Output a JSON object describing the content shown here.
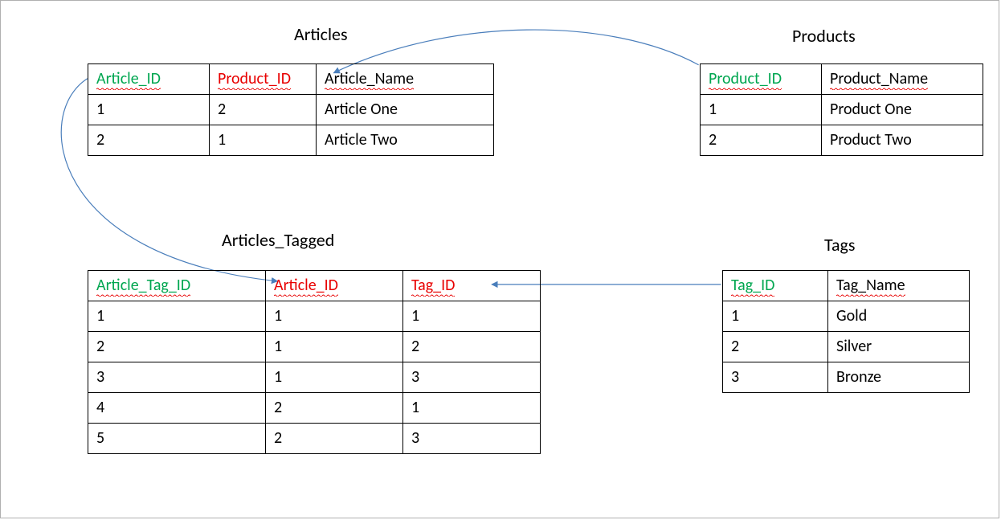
{
  "colors": {
    "pk": "#00a650",
    "fk": "#e80000",
    "connector": "#4a7ebb"
  },
  "connectors": [
    {
      "from": "Products.Product_ID",
      "to": "Articles.Product_ID"
    },
    {
      "from": "Articles.Article_ID",
      "to": "Articles_Tagged.Article_ID"
    },
    {
      "from": "Tags.Tag_ID",
      "to": "Articles_Tagged.Tag_ID"
    }
  ],
  "tables": {
    "articles": {
      "title": "Articles",
      "columns": [
        {
          "name": "Article_ID",
          "role": "pk"
        },
        {
          "name": "Product_ID",
          "role": "fk"
        },
        {
          "name": "Article_Name",
          "role": "plain"
        }
      ],
      "rows": [
        {
          "c0": "1",
          "c1": "2",
          "c2": "Article One"
        },
        {
          "c0": "2",
          "c1": "1",
          "c2": "Article Two"
        }
      ]
    },
    "products": {
      "title": "Products",
      "columns": [
        {
          "name": "Product_ID",
          "role": "pk"
        },
        {
          "name": "Product_Name",
          "role": "plain"
        }
      ],
      "rows": [
        {
          "c0": "1",
          "c1": "Product One"
        },
        {
          "c0": "2",
          "c1": "Product Two"
        }
      ]
    },
    "articles_tagged": {
      "title": "Articles_Tagged",
      "columns": [
        {
          "name": "Article_Tag_ID",
          "role": "pk"
        },
        {
          "name": "Article_ID",
          "role": "fk"
        },
        {
          "name": "Tag_ID",
          "role": "fk"
        }
      ],
      "rows": [
        {
          "c0": "1",
          "c1": "1",
          "c2": "1"
        },
        {
          "c0": "2",
          "c1": "1",
          "c2": "2"
        },
        {
          "c0": "3",
          "c1": "1",
          "c2": "3"
        },
        {
          "c0": "4",
          "c1": "2",
          "c2": "1"
        },
        {
          "c0": "5",
          "c1": "2",
          "c2": "3"
        }
      ]
    },
    "tags": {
      "title": "Tags",
      "columns": [
        {
          "name": "Tag_ID",
          "role": "pk"
        },
        {
          "name": "Tag_Name",
          "role": "plain"
        }
      ],
      "rows": [
        {
          "c0": "1",
          "c1": "Gold"
        },
        {
          "c0": "2",
          "c1": "Silver"
        },
        {
          "c0": "3",
          "c1": "Bronze"
        }
      ]
    }
  }
}
